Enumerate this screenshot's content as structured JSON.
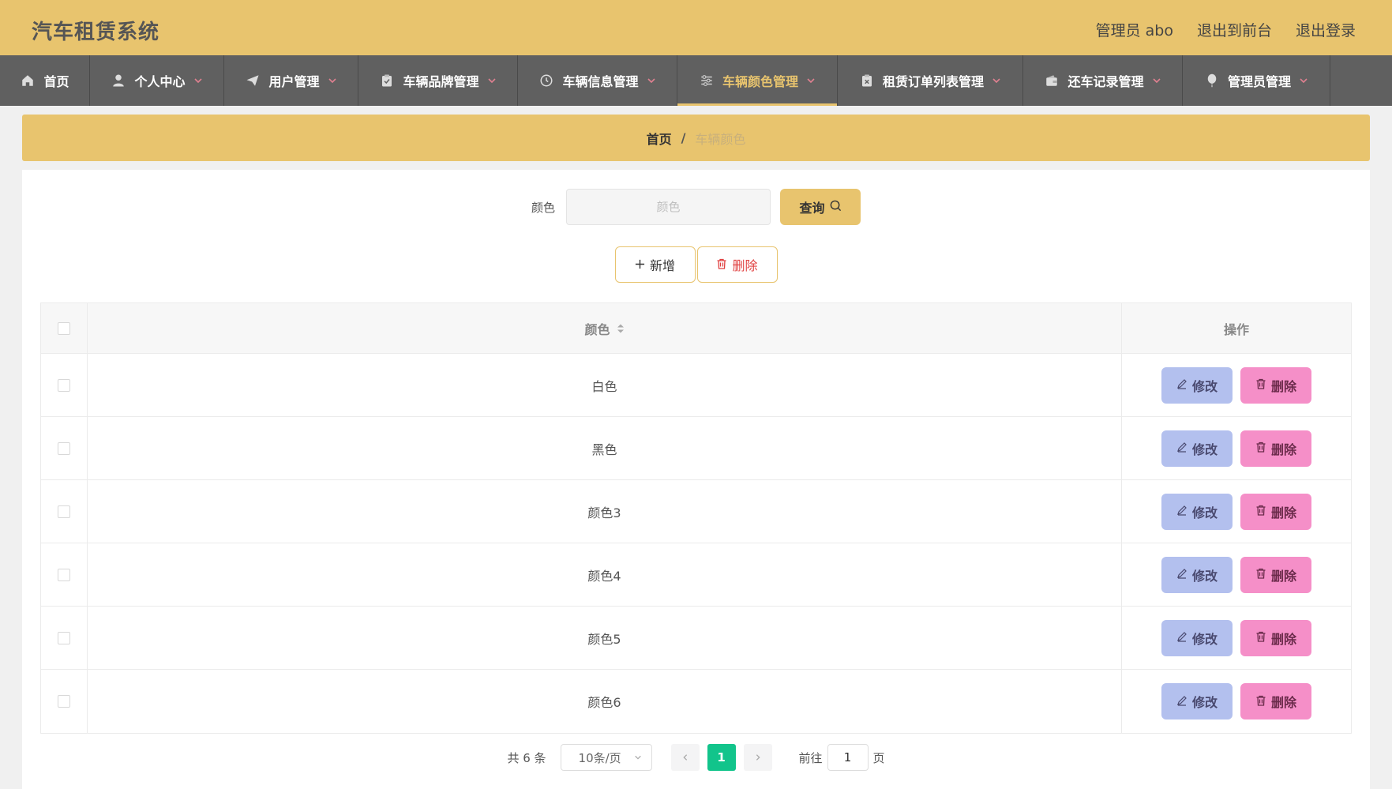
{
  "header": {
    "app_title": "汽车租赁系统",
    "admin_label": "管理员 abo",
    "goto_front": "退出到前台",
    "logout": "退出登录"
  },
  "nav": {
    "items": [
      {
        "label": "首页",
        "icon": "home-icon",
        "dropdown": false
      },
      {
        "label": "个人中心",
        "icon": "user-icon",
        "dropdown": true
      },
      {
        "label": "用户管理",
        "icon": "send-icon",
        "dropdown": true
      },
      {
        "label": "车辆品牌管理",
        "icon": "clipboard-icon",
        "dropdown": true
      },
      {
        "label": "车辆信息管理",
        "icon": "clock-icon",
        "dropdown": true
      },
      {
        "label": "车辆颜色管理",
        "icon": "sliders-icon",
        "dropdown": true,
        "active": true
      },
      {
        "label": "租赁订单列表管理",
        "icon": "clipboard-x-icon",
        "dropdown": true
      },
      {
        "label": "还车记录管理",
        "icon": "wallet-icon",
        "dropdown": true
      },
      {
        "label": "管理员管理",
        "icon": "balloon-icon",
        "dropdown": true
      }
    ]
  },
  "breadcrumb": {
    "home": "首页",
    "separator": "/",
    "current": "车辆颜色"
  },
  "search": {
    "label": "颜色",
    "placeholder": "颜色",
    "value": "",
    "button": "查询"
  },
  "actions": {
    "add": "新增",
    "delete": "删除"
  },
  "table": {
    "columns": {
      "color": "颜色",
      "ops": "操作"
    },
    "edit_label": "修改",
    "delete_label": "删除",
    "rows": [
      {
        "color": "白色"
      },
      {
        "color": "黑色"
      },
      {
        "color": "颜色3"
      },
      {
        "color": "颜色4"
      },
      {
        "color": "颜色5"
      },
      {
        "color": "颜色6"
      }
    ]
  },
  "pagination": {
    "total": "共 6 条",
    "page_size": "10条/页",
    "current_page": "1",
    "goto_label": "前往",
    "goto_value": "1",
    "page_suffix": "页"
  },
  "colors": {
    "accent": "#e8c46e",
    "nav_bg": "#606060",
    "edit_btn": "#b3c0ee",
    "delete_btn": "#f58fc8",
    "page_active": "#12c48b"
  }
}
